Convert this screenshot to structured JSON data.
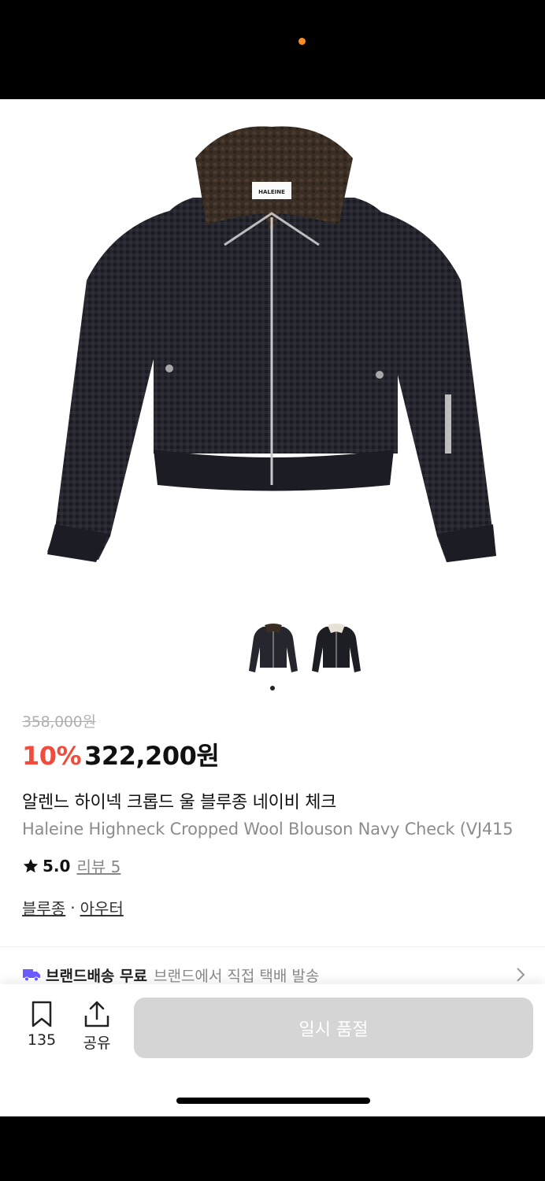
{
  "status_bar": {
    "indicator_color": "#ff8a1f"
  },
  "product": {
    "image_alt": "jacket-image",
    "thumbnails": [
      "thumbnail-navy-jacket",
      "thumbnail-jacket-cream-collar"
    ],
    "original_price": "358,000원",
    "discount": "10%",
    "sale_price": "322,200원",
    "name_ko": "알렌느 하이넥 크롭드 울 블루종 네이비 체크",
    "name_en": "Haleine Highneck Cropped Wool Blouson Navy Check (VJ415",
    "rating": "5.0",
    "review_link": "리뷰 5",
    "categories": [
      "블루종",
      "아우터"
    ],
    "category_separator": "·",
    "brand_label": "HALEINE"
  },
  "delivery": {
    "strong": "브랜드배송 무료",
    "desc": "브랜드에서 직접 택배 발송"
  },
  "bottom_bar": {
    "save_count": "135",
    "share_label": "공유",
    "buy_label": "일시 품절"
  },
  "colors": {
    "discount": "#f04b3b",
    "delivery_icon": "#6b5cff",
    "buy_disabled": "#d5d5d5"
  }
}
